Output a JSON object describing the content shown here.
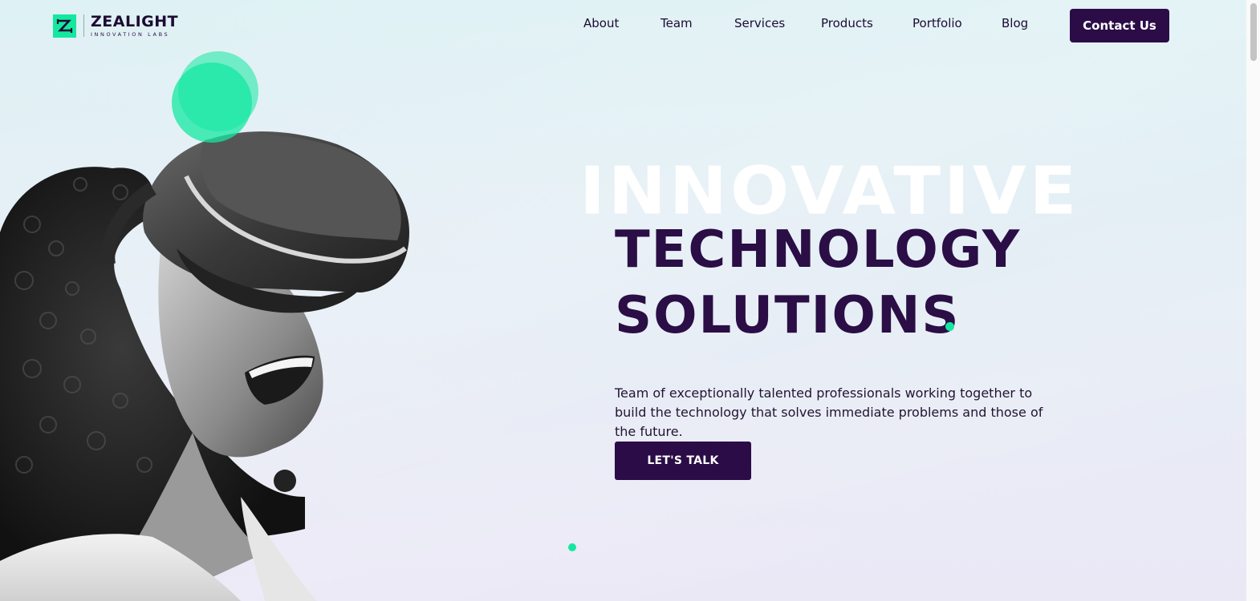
{
  "brand": {
    "name": "ZEALIGHT",
    "tagline": "INNOVATION LABS",
    "accent_color": "#14e8a0",
    "primary_color": "#2b0c47"
  },
  "nav": {
    "items": [
      {
        "label": "About"
      },
      {
        "label": "Team"
      },
      {
        "label": "Services"
      },
      {
        "label": "Products"
      },
      {
        "label": "Portfolio"
      },
      {
        "label": "Blog"
      }
    ],
    "contact_label": "Contact Us"
  },
  "hero": {
    "ghost_word": "INNOVATIVE",
    "line1": "TECHNOLOGY",
    "line2": "SOLUTIONS",
    "description": "Team of exceptionally talented professionals working together to build the technology that solves immediate problems and those of the future.",
    "cta_label": "LET'S TALK",
    "image_icon": "vr-headset-person-image"
  }
}
